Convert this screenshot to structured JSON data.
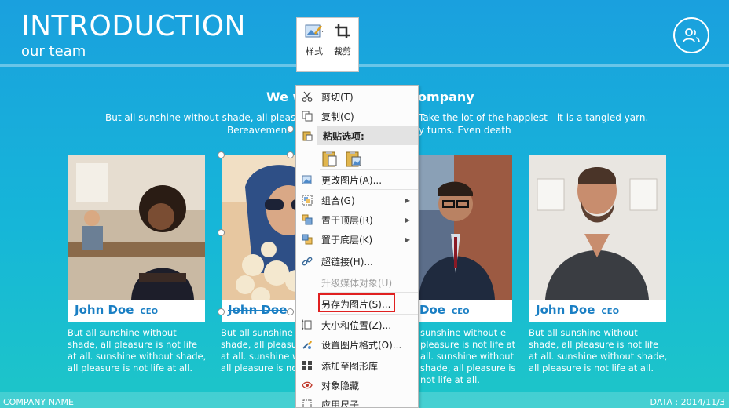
{
  "slide": {
    "title": "INTRODUCTION",
    "subtitle": "our team",
    "heading_left": "We w",
    "heading_right": "ompany",
    "intro_l1": "But all sunshine without shade, all pleasure w",
    "intro_l2": "Bereavement",
    "intro_r1": "Take the lot of the happiest - it is a tangled yarn.",
    "intro_r2": "y turns. Even death",
    "footer_company": "COMPANY NAME",
    "footer_date": "DATA : 2014/11/3"
  },
  "cards": [
    {
      "name": "John Doe",
      "role": "CEO",
      "desc": "But all sunshine without shade, all pleasure is not life at all. sunshine without shade, all pleasure is not life at all."
    },
    {
      "name": "John Doe",
      "role": "",
      "desc": "But all sunshine without shade, all pleasure is not life at all. sunshine without shade, all pleasure is not life at all."
    },
    {
      "name": "Doe",
      "role": "CEO",
      "desc": "sunshine without e pleasure is not life at all. sunshine without shade, all pleasure is not life at all."
    },
    {
      "name": "John Doe",
      "role": "CEO",
      "desc": "But all sunshine without shade, all pleasure is not life at all. sunshine without shade, all pleasure is not life at all."
    }
  ],
  "mini_toolbar": {
    "style_label": "样式",
    "crop_label": "裁剪"
  },
  "context_menu": {
    "cut": "剪切(T)",
    "copy": "复制(C)",
    "paste_options": "粘贴选项:",
    "change_picture": "更改图片(A)...",
    "group": "组合(G)",
    "bring_front": "置于顶层(R)",
    "send_back": "置于底层(K)",
    "hyperlink": "超链接(H)...",
    "upgrade_media": "升级媒体对象(U)",
    "save_as_picture": "另存为图片(S)...",
    "size_position": "大小和位置(Z)...",
    "format_picture": "设置图片格式(O)...",
    "add_to_shapes": "添加至图形库",
    "hide_object": "对象隐藏",
    "apply_size": "应用尺子"
  },
  "colors": {
    "accent_blue": "#1a7fc4",
    "highlight_red": "#e02020"
  }
}
